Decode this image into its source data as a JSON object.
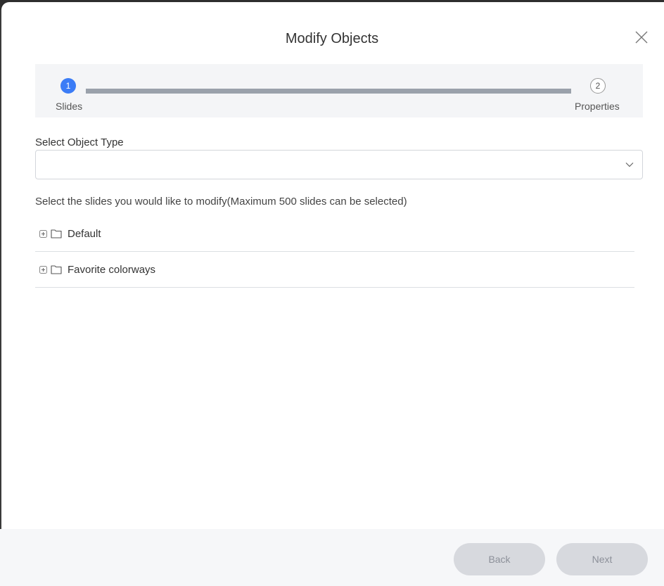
{
  "dialog": {
    "title": "Modify Objects",
    "close_icon": "close-icon"
  },
  "stepper": {
    "steps": [
      {
        "number": "1",
        "label": "Slides",
        "state": "active"
      },
      {
        "number": "2",
        "label": "Properties",
        "state": "inactive"
      }
    ],
    "colors": {
      "active": "#3b7cf6",
      "bar": "#9aa1ab"
    }
  },
  "object_type": {
    "label": "Select Object Type",
    "value": "",
    "chevron_icon": "chevron-down-icon"
  },
  "slides": {
    "instruction": "Select the slides you would like to modify(Maximum 500 slides can be selected)",
    "folders": [
      {
        "label": "Default",
        "expand_icon": "plus-square-icon",
        "icon": "folder-icon"
      },
      {
        "label": "Favorite colorways",
        "expand_icon": "plus-square-icon",
        "icon": "folder-icon"
      }
    ]
  },
  "footer": {
    "back_label": "Back",
    "next_label": "Next"
  }
}
